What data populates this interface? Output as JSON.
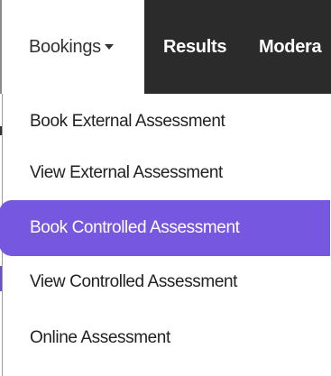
{
  "navbar": {
    "items": [
      {
        "label": "Bookings",
        "active": true,
        "has_caret": true
      },
      {
        "label": "Results",
        "active": false
      },
      {
        "label": "Modera",
        "active": false
      }
    ]
  },
  "dropdown": {
    "items": [
      {
        "label": "Book External Assessment",
        "highlighted": false
      },
      {
        "label": "View External Assessment",
        "highlighted": false
      },
      {
        "label": "Book Controlled Assessment",
        "highlighted": true
      },
      {
        "label": "View Controlled Assessment",
        "highlighted": false
      },
      {
        "label": "Online Assessment",
        "highlighted": false
      }
    ]
  },
  "colors": {
    "navbar_bg": "#2b2b2b",
    "highlight": "#7658e0",
    "text": "#222222"
  }
}
